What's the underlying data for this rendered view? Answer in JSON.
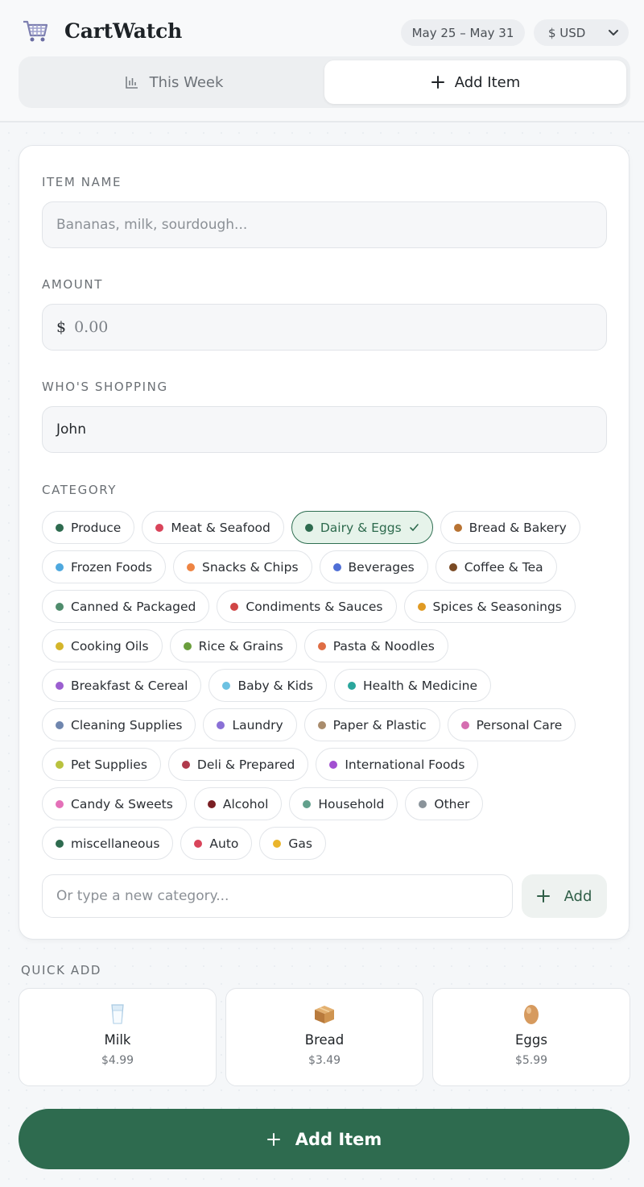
{
  "app": {
    "title": "CartWatch"
  },
  "header": {
    "date_range": "May 25 – May 31",
    "currency": "$ USD"
  },
  "tabs": [
    {
      "label": "This Week",
      "icon": "bar-chart-icon",
      "active": false
    },
    {
      "label": "Add Item",
      "icon": "plus-icon",
      "active": true
    }
  ],
  "form": {
    "item_name": {
      "label": "ITEM NAME",
      "placeholder": "Bananas, milk, sourdough..."
    },
    "amount": {
      "label": "AMOUNT",
      "symbol": "$",
      "placeholder": "0.00"
    },
    "shopper": {
      "label": "WHO'S SHOPPING",
      "value": "John"
    },
    "category": {
      "label": "CATEGORY"
    },
    "new_category": {
      "placeholder": "Or type a new category...",
      "add_label": "Add"
    }
  },
  "categories": [
    [
      {
        "label": "Produce",
        "color": "#2e6b4f"
      },
      {
        "label": "Meat & Seafood",
        "color": "#d9445a"
      },
      {
        "label": "Dairy & Eggs",
        "color": "#2e6b4f",
        "selected": true
      },
      {
        "label": "Bread & Bakery",
        "color": "#b87333"
      }
    ],
    [
      {
        "label": "Frozen Foods",
        "color": "#4ea8de"
      },
      {
        "label": "Snacks & Chips",
        "color": "#ee8443"
      },
      {
        "label": "Beverages",
        "color": "#4f6fd6"
      },
      {
        "label": "Coffee & Tea",
        "color": "#7a4a24"
      }
    ],
    [
      {
        "label": "Canned & Packaged",
        "color": "#4f8c6c"
      },
      {
        "label": "Condiments & Sauces",
        "color": "#d04545"
      },
      {
        "label": "Spices & Seasonings",
        "color": "#e09a23"
      }
    ],
    [
      {
        "label": "Cooking Oils",
        "color": "#d4b52a"
      },
      {
        "label": "Rice & Grains",
        "color": "#6a9e3c"
      },
      {
        "label": "Pasta & Noodles",
        "color": "#df6d44"
      }
    ],
    [
      {
        "label": "Breakfast & Cereal",
        "color": "#9b5fd0"
      },
      {
        "label": "Baby & Kids",
        "color": "#6cc1e2"
      },
      {
        "label": "Health & Medicine",
        "color": "#2aa69c"
      }
    ],
    [
      {
        "label": "Cleaning Supplies",
        "color": "#6f86ae"
      },
      {
        "label": "Laundry",
        "color": "#8a70d6"
      },
      {
        "label": "Paper & Plastic",
        "color": "#a98c6c"
      },
      {
        "label": "Personal Care",
        "color": "#d56db0"
      }
    ],
    [
      {
        "label": "Pet Supplies",
        "color": "#b9c23e"
      },
      {
        "label": "Deli & Prepared",
        "color": "#b03a4c"
      },
      {
        "label": "International Foods",
        "color": "#a24fd1"
      }
    ],
    [
      {
        "label": "Candy & Sweets",
        "color": "#e470b8"
      },
      {
        "label": "Alcohol",
        "color": "#7a1f24"
      },
      {
        "label": "Household",
        "color": "#62a08c"
      },
      {
        "label": "Other",
        "color": "#8a939a"
      }
    ],
    [
      {
        "label": "miscellaneous",
        "color": "#2e6b4f"
      },
      {
        "label": "Auto",
        "color": "#d9445a"
      },
      {
        "label": "Gas",
        "color": "#eab52b"
      }
    ]
  ],
  "quick_add": {
    "label": "QUICK ADD",
    "items": [
      {
        "name": "Milk",
        "price": "$4.99",
        "icon": "milk-glass-icon"
      },
      {
        "name": "Bread",
        "price": "$3.49",
        "icon": "bread-box-icon"
      },
      {
        "name": "Eggs",
        "price": "$5.99",
        "icon": "egg-icon"
      }
    ]
  },
  "submit": {
    "label": "Add Item"
  }
}
